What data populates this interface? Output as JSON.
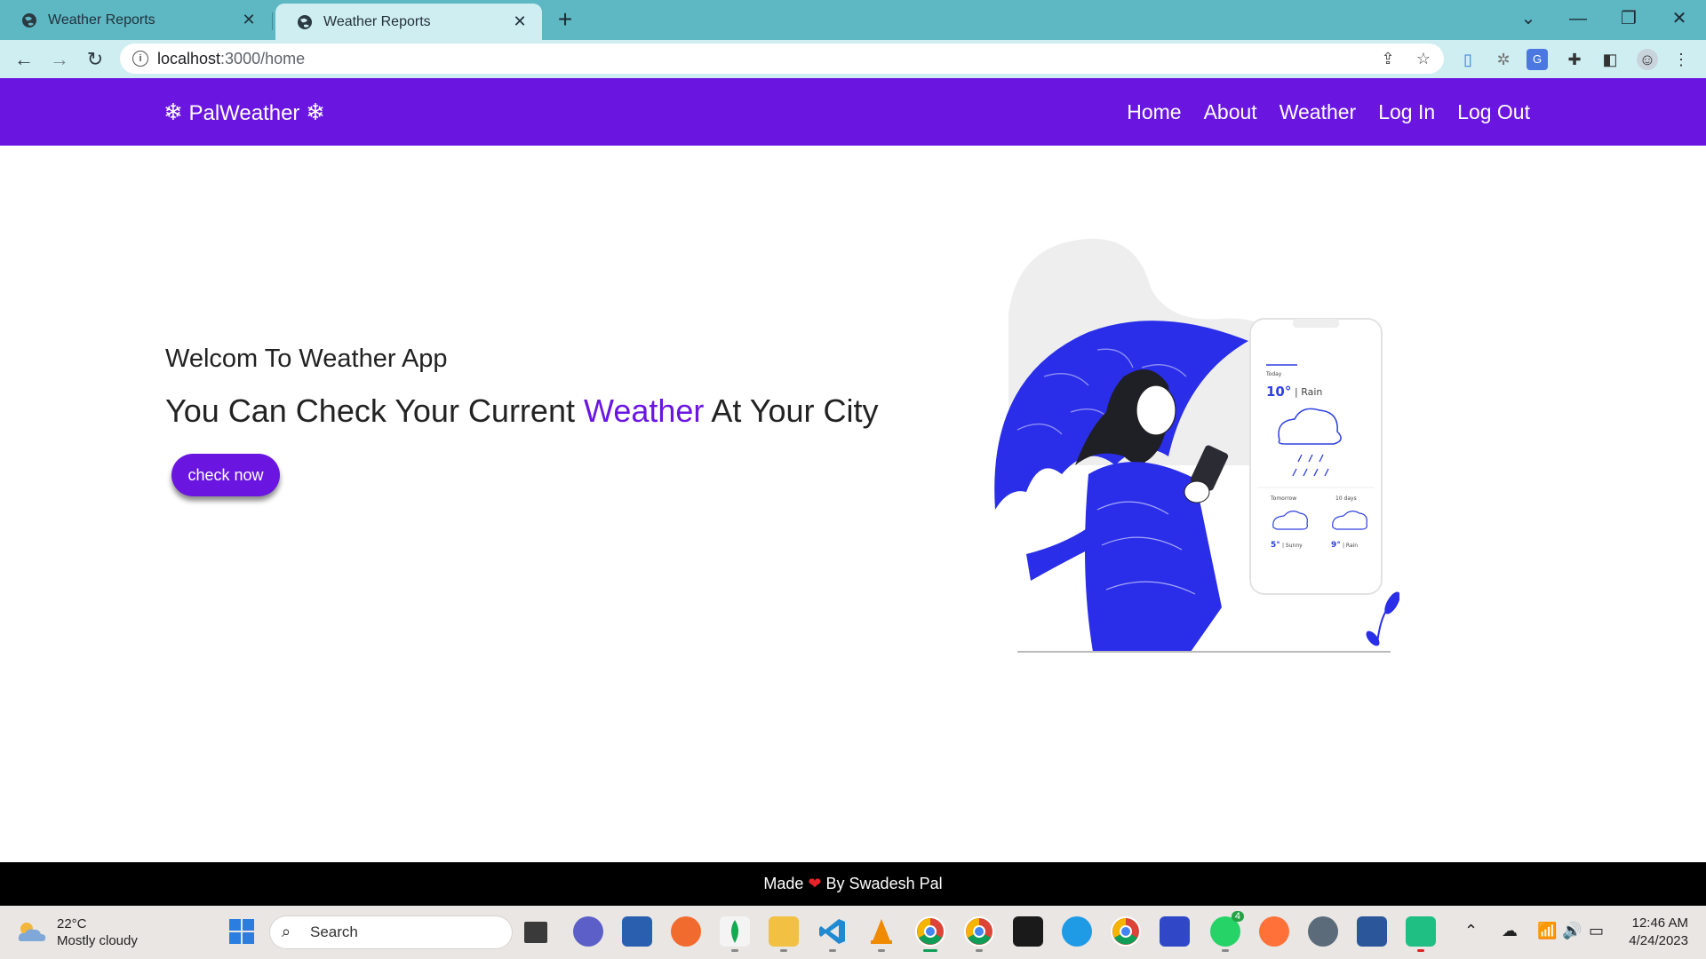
{
  "browser": {
    "tabs": [
      {
        "title": "Weather Reports",
        "active": false
      },
      {
        "title": "Weather Reports",
        "active": true
      }
    ],
    "url_host": "localhost",
    "url_path": ":3000/home"
  },
  "site": {
    "brand": "PalWeather",
    "brand_icon": "snowflake-icon",
    "nav": [
      "Home",
      "About",
      "Weather",
      "Log In",
      "Log Out"
    ],
    "welcome": "Welcom To Weather App",
    "tagline_before": "You Can Check Your Current ",
    "tagline_accent": "Weather",
    "tagline_after": " At Your City",
    "cta": "check now",
    "footer_before": "Made",
    "footer_after": "By Swadesh Pal",
    "accent_color": "#6a16e0"
  },
  "illustration": {
    "today": "Today",
    "temp_main": "10°",
    "cond_main": "| Rain",
    "tomorrow": "Tomorrow",
    "ten_days": "10 days",
    "temp_a": "5°",
    "cond_a": "| Sunny",
    "temp_b": "9°",
    "cond_b": "| Rain"
  },
  "taskbar": {
    "temp": "22°C",
    "condition": "Mostly cloudy",
    "search_placeholder": "Search",
    "time": "12:46 AM",
    "date": "4/24/2023",
    "whatsapp_badge": "4"
  }
}
